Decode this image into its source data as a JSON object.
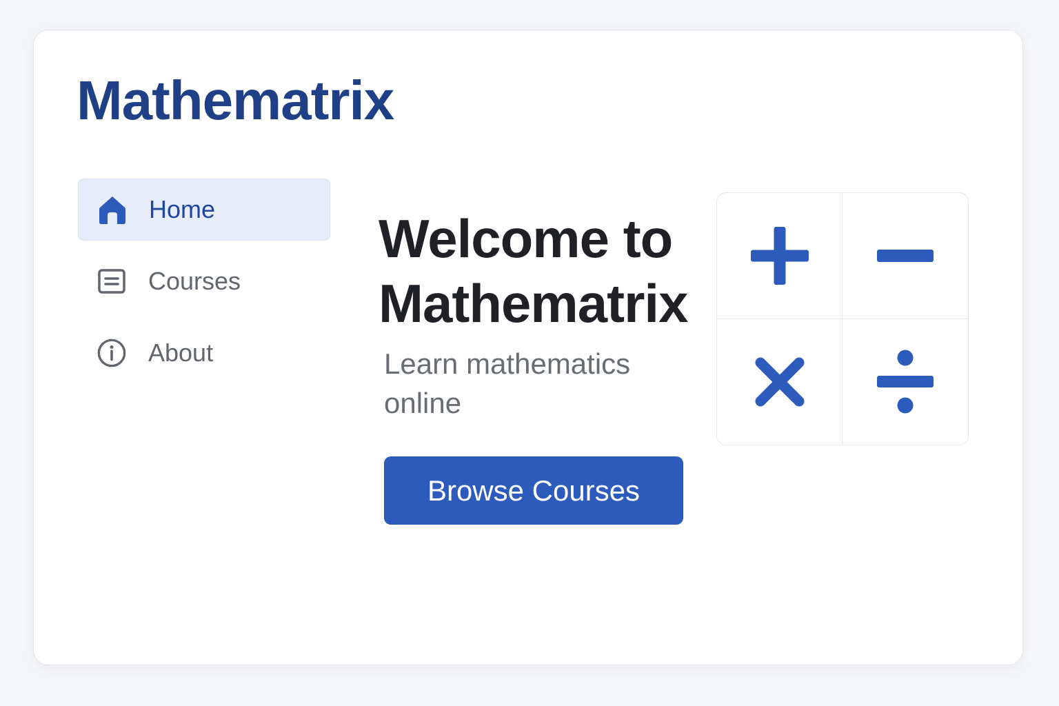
{
  "app": {
    "title": "Mathematrix"
  },
  "sidebar": {
    "items": [
      {
        "label": "Home",
        "icon": "home-icon",
        "active": true
      },
      {
        "label": "Courses",
        "icon": "courses-icon",
        "active": false
      },
      {
        "label": "About",
        "icon": "info-icon",
        "active": false
      }
    ]
  },
  "hero": {
    "title": "Welcome to Mathematrix",
    "subtitle": "Learn mathematics online",
    "cta_label": "Browse Courses"
  },
  "operations": [
    {
      "name": "plus",
      "icon": "plus-icon"
    },
    {
      "name": "minus",
      "icon": "minus-icon"
    },
    {
      "name": "multiply",
      "icon": "multiply-icon"
    },
    {
      "name": "divide",
      "icon": "divide-icon"
    }
  ],
  "colors": {
    "brand": "#1f3f86",
    "accent": "#2d5bbb",
    "active_bg": "#e6ecfa",
    "muted_text": "#61656c"
  }
}
